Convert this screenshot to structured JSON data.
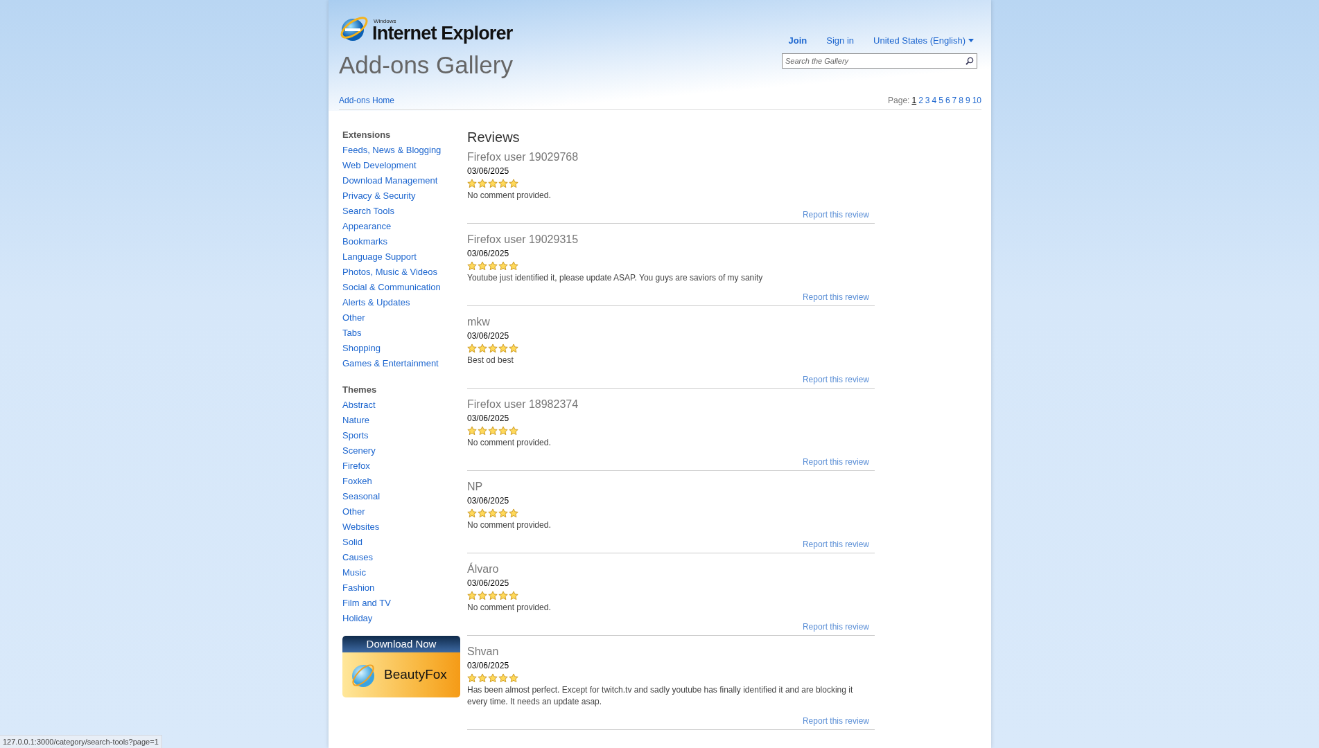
{
  "header": {
    "logo": {
      "small": "Windows",
      "name": "Internet Explorer"
    },
    "title": "Add-ons Gallery",
    "nav": [
      {
        "label": "Join",
        "bold": true,
        "dropdown": false
      },
      {
        "label": "Sign in",
        "bold": false,
        "dropdown": false
      },
      {
        "label": "United States (English)",
        "bold": false,
        "dropdown": true
      }
    ],
    "search": {
      "placeholder": "Search the Gallery"
    },
    "breadcrumb": "Add-ons Home",
    "pagination": {
      "label": "Page:",
      "pages": [
        {
          "label": "1",
          "selected": true
        },
        {
          "label": "2",
          "selected": false
        },
        {
          "label": "3",
          "selected": false
        },
        {
          "label": "4",
          "selected": false
        },
        {
          "label": "5",
          "selected": false
        },
        {
          "label": "6",
          "selected": false
        },
        {
          "label": "7",
          "selected": false
        },
        {
          "label": "8",
          "selected": false
        },
        {
          "label": "9",
          "selected": false
        },
        {
          "label": "10",
          "selected": false
        }
      ]
    }
  },
  "sidebar": {
    "sections": [
      {
        "heading": "Extensions",
        "items": [
          "Feeds, News & Blogging",
          "Web Development",
          "Download Management",
          "Privacy & Security",
          "Search Tools",
          "Appearance",
          "Bookmarks",
          "Language Support",
          "Photos, Music & Videos",
          "Social & Communication",
          "Alerts & Updates",
          "Other",
          "Tabs",
          "Shopping",
          "Games & Entertainment"
        ]
      },
      {
        "heading": "Themes",
        "items": [
          "Abstract",
          "Nature",
          "Sports",
          "Scenery",
          "Firefox",
          "Foxkeh",
          "Seasonal",
          "Other",
          "Websites",
          "Solid",
          "Causes",
          "Music",
          "Fashion",
          "Film and TV",
          "Holiday"
        ]
      }
    ],
    "banner": {
      "top": "Download Now",
      "name": "BeautyFox"
    }
  },
  "reviews": {
    "heading": "Reviews",
    "items": [
      {
        "author": "Firefox user 19029768",
        "date": "03/06/2025",
        "stars": 5,
        "comment": "No comment provided.",
        "report": "Report this review"
      },
      {
        "author": "Firefox user 19029315",
        "date": "03/06/2025",
        "stars": 5,
        "comment": "Youtube just identified it, please update ASAP. You guys are saviors of my sanity",
        "report": "Report this review"
      },
      {
        "author": "mkw",
        "date": "03/06/2025",
        "stars": 5,
        "comment": "Best od best",
        "report": "Report this review"
      },
      {
        "author": "Firefox user 18982374",
        "date": "03/06/2025",
        "stars": 5,
        "comment": "No comment provided.",
        "report": "Report this review"
      },
      {
        "author": "NP",
        "date": "03/06/2025",
        "stars": 5,
        "comment": "No comment provided.",
        "report": "Report this review"
      },
      {
        "author": "Álvaro",
        "date": "03/06/2025",
        "stars": 5,
        "comment": "No comment provided.",
        "report": "Report this review"
      },
      {
        "author": "Shvan",
        "date": "03/06/2025",
        "stars": 5,
        "comment": "Has been almost perfect. Except for twitch.tv and sadly youtube has finally identified it and are blocking it every time. It needs an update asap.",
        "report": "Report this review"
      }
    ]
  },
  "status_bar": "127.0.0.1:3000/category/search-tools?page=1"
}
